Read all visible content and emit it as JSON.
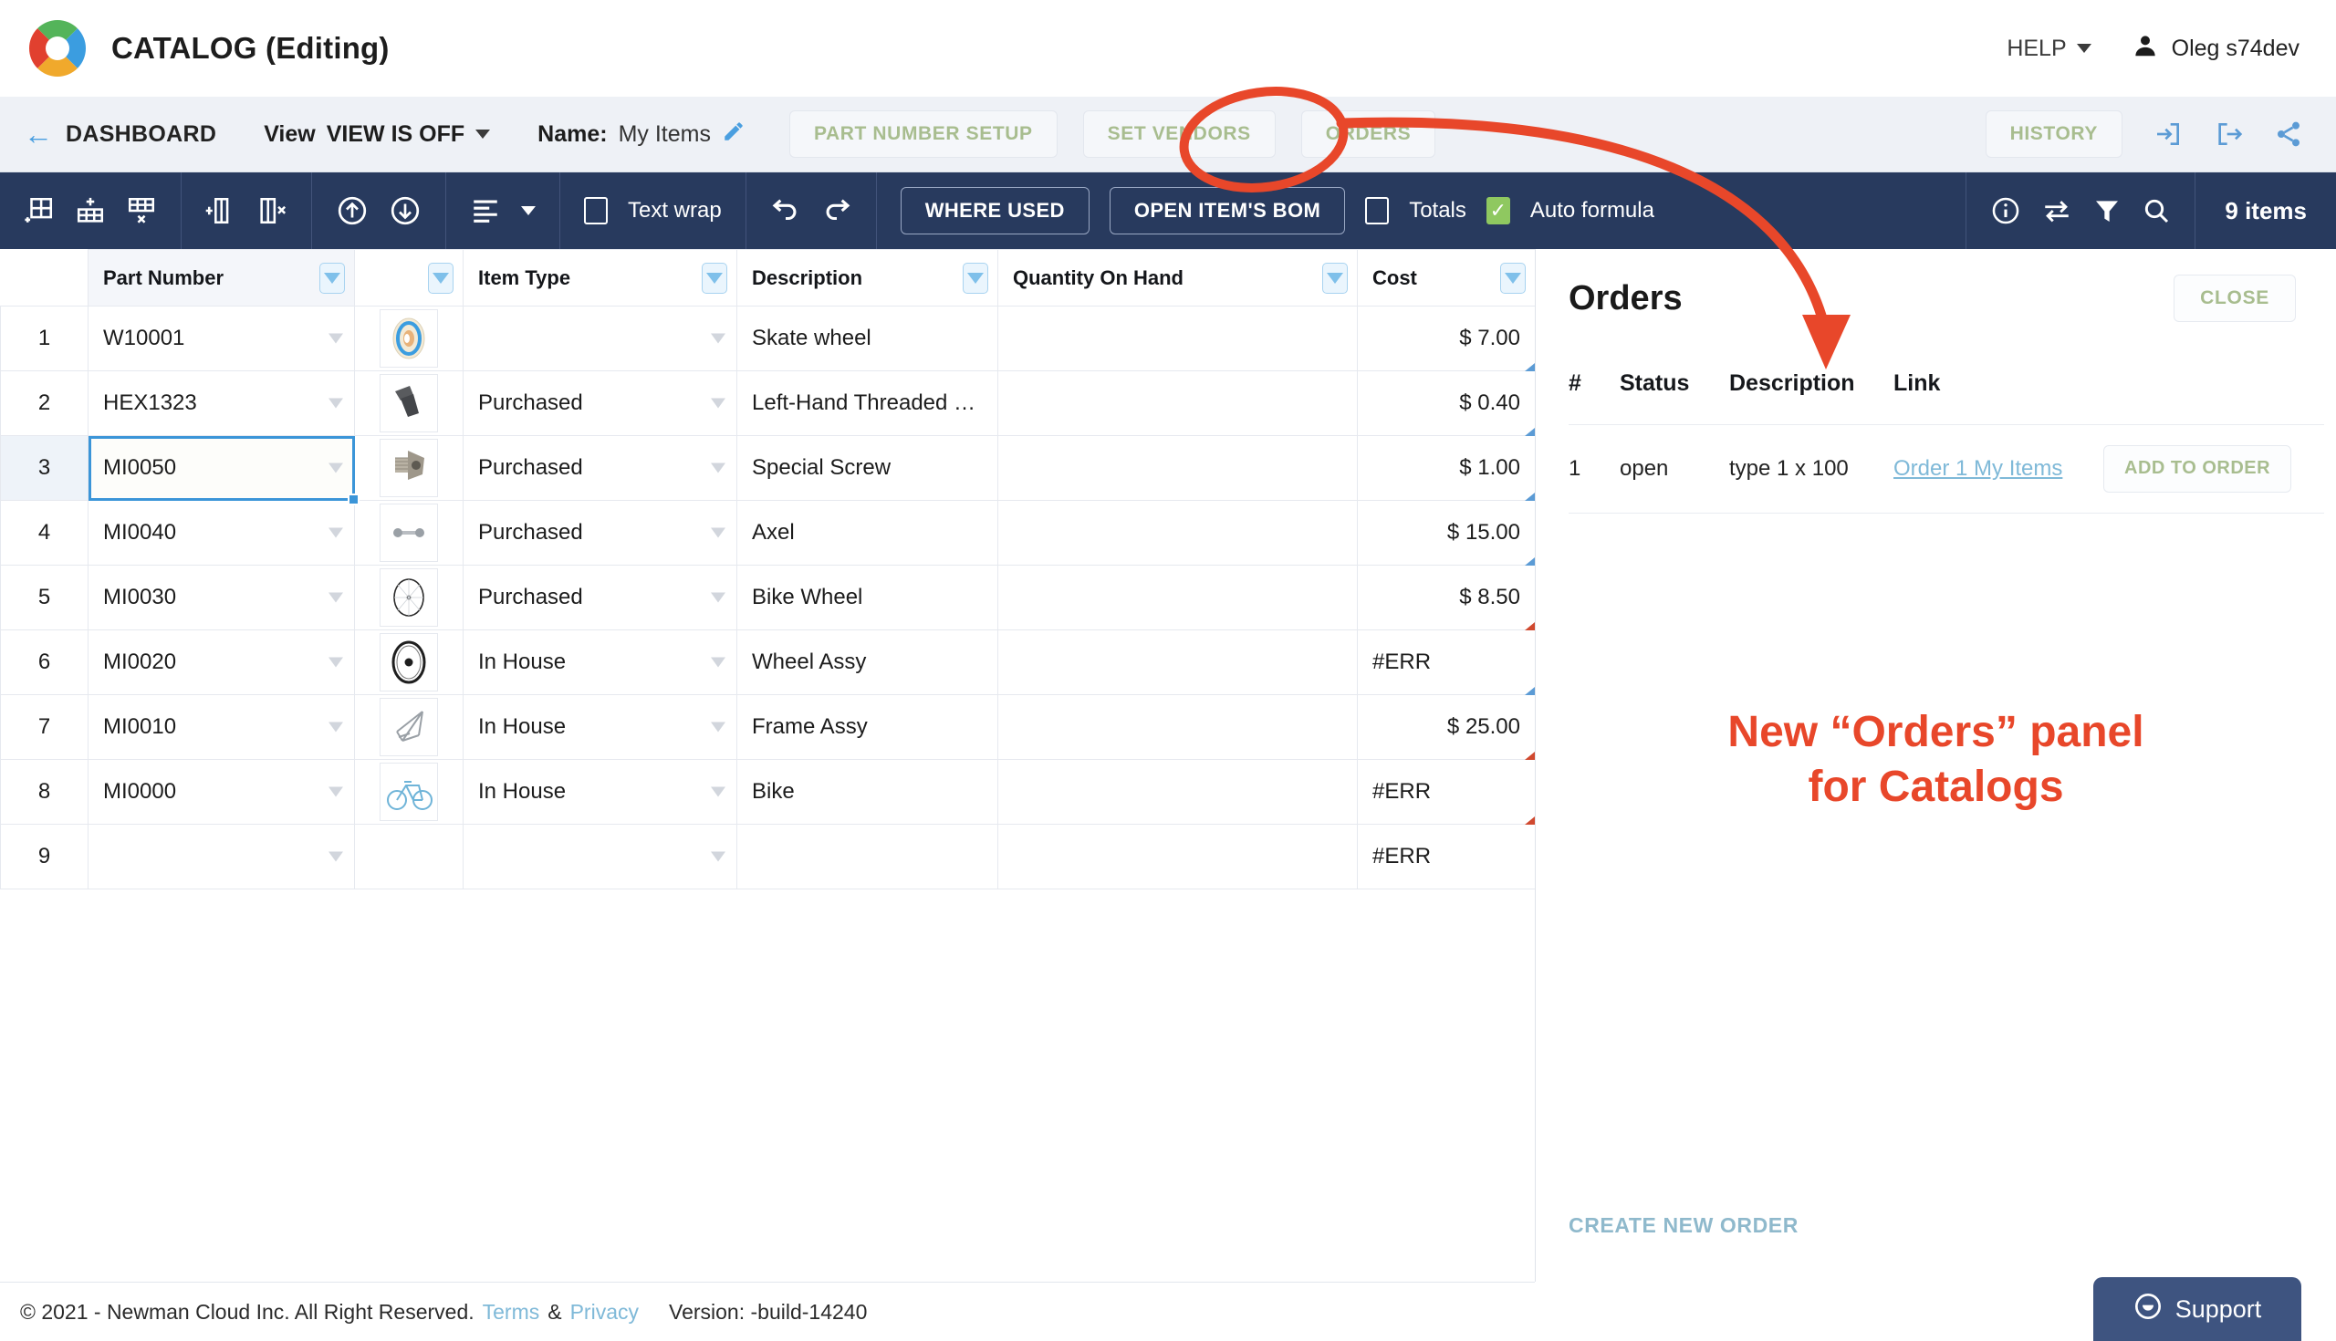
{
  "header": {
    "app_title": "CATALOG (Editing)",
    "help_label": "HELP",
    "user_name": "Oleg s74dev",
    "logo_icon": "catalog-ring-logo",
    "user_icon": "person-icon",
    "caret_icon": "chevron-down-icon"
  },
  "subheader": {
    "back_icon": "arrow-left-icon",
    "dashboard_label": "DASHBOARD",
    "view_word": "View",
    "view_value": "VIEW IS OFF",
    "view_caret_icon": "chevron-down-icon",
    "name_label": "Name:",
    "name_value": "My Items",
    "edit_icon": "pencil-icon",
    "buttons": [
      {
        "label": "PART NUMBER SETUP",
        "name": "part-number-setup-button"
      },
      {
        "label": "SET VENDORS",
        "name": "set-vendors-button"
      },
      {
        "label": "ORDERS",
        "name": "orders-button"
      }
    ],
    "history_label": "HISTORY",
    "icons": [
      {
        "name": "import-icon"
      },
      {
        "name": "export-icon"
      },
      {
        "name": "share-icon"
      }
    ]
  },
  "toolbar": {
    "icons_group1": [
      {
        "name": "insert-row-icon"
      },
      {
        "name": "add-row-icon"
      },
      {
        "name": "delete-row-icon"
      }
    ],
    "icons_group2": [
      {
        "name": "add-column-icon"
      },
      {
        "name": "delete-column-icon"
      }
    ],
    "icons_group3": [
      {
        "name": "move-up-icon"
      },
      {
        "name": "move-down-icon"
      }
    ],
    "icons_group4": [
      {
        "name": "align-icon"
      }
    ],
    "text_wrap_label": "Text wrap",
    "undo_icon": "undo-icon",
    "redo_icon": "redo-icon",
    "where_used_label": "WHERE USED",
    "open_items_bom_label": "OPEN ITEM'S BOM",
    "totals_label": "Totals",
    "totals_checked": false,
    "auto_formula_label": "Auto formula",
    "auto_formula_checked": true,
    "right_icons": [
      {
        "name": "info-icon"
      },
      {
        "name": "swap-icon"
      },
      {
        "name": "filter-icon"
      },
      {
        "name": "search-icon"
      }
    ],
    "items_count": "9 items"
  },
  "grid": {
    "columns": [
      "",
      "Part Number",
      "",
      "Item Type",
      "Description",
      "Quantity On Hand",
      "Cost"
    ],
    "rows": [
      {
        "num": "1",
        "part": "W10001",
        "thumb": "skate-wheel-thumb",
        "type": "",
        "desc": "Skate wheel",
        "qty": "",
        "cost": "$ 7.00",
        "cost_err": false,
        "marker": "blue"
      },
      {
        "num": "2",
        "part": "HEX1323",
        "thumb": "bolt-thumb",
        "type": "Purchased",
        "desc": "Left-Hand Threaded …",
        "qty": "",
        "cost": "$ 0.40",
        "cost_err": false,
        "marker": "blue"
      },
      {
        "num": "3",
        "part": "MI0050",
        "thumb": "screw-thumb",
        "type": "Purchased",
        "desc": "Special Screw",
        "qty": "",
        "cost": "$ 1.00",
        "cost_err": false,
        "marker": "blue",
        "selected": true
      },
      {
        "num": "4",
        "part": "MI0040",
        "thumb": "axle-thumb",
        "type": "Purchased",
        "desc": "Axel",
        "qty": "",
        "cost": "$ 15.00",
        "cost_err": false,
        "marker": "blue"
      },
      {
        "num": "5",
        "part": "MI0030",
        "thumb": "bike-wheel-thumb",
        "type": "Purchased",
        "desc": "Bike Wheel",
        "qty": "",
        "cost": "$ 8.50",
        "cost_err": false,
        "marker": "red"
      },
      {
        "num": "6",
        "part": "MI0020",
        "thumb": "wheel-assy-thumb",
        "type": "In House",
        "desc": "Wheel Assy",
        "qty": "",
        "cost": "#ERR",
        "cost_err": true,
        "marker": "blue"
      },
      {
        "num": "7",
        "part": "MI0010",
        "thumb": "frame-thumb",
        "type": "In House",
        "desc": "Frame Assy",
        "qty": "",
        "cost": "$ 25.00",
        "cost_err": false,
        "marker": "red"
      },
      {
        "num": "8",
        "part": "MI0000",
        "thumb": "bicycle-thumb",
        "type": "In House",
        "desc": "Bike",
        "qty": "",
        "cost": "#ERR",
        "cost_err": true,
        "marker": "red"
      },
      {
        "num": "9",
        "part": "",
        "thumb": "",
        "type": "",
        "desc": "",
        "qty": "",
        "cost": "#ERR",
        "cost_err": true,
        "marker": "none"
      }
    ]
  },
  "orders_panel": {
    "title": "Orders",
    "close_label": "CLOSE",
    "columns": [
      "#",
      "Status",
      "Description",
      "Link"
    ],
    "rows": [
      {
        "num": "1",
        "status": "open",
        "desc": "type 1 x 100",
        "link": "Order 1 My Items",
        "action": "ADD TO ORDER"
      }
    ],
    "create_label": "CREATE NEW ORDER"
  },
  "annotation": {
    "line1": "New “Orders” panel",
    "line2": "for Catalogs",
    "color": "#e8472a"
  },
  "footer": {
    "copyright": "© 2021 - Newman Cloud Inc. All Right Reserved.",
    "terms": "Terms",
    "amp": "&",
    "privacy": "Privacy",
    "version": "Version: -build-14240",
    "support_label": "Support",
    "support_icon": "smiley-icon"
  }
}
